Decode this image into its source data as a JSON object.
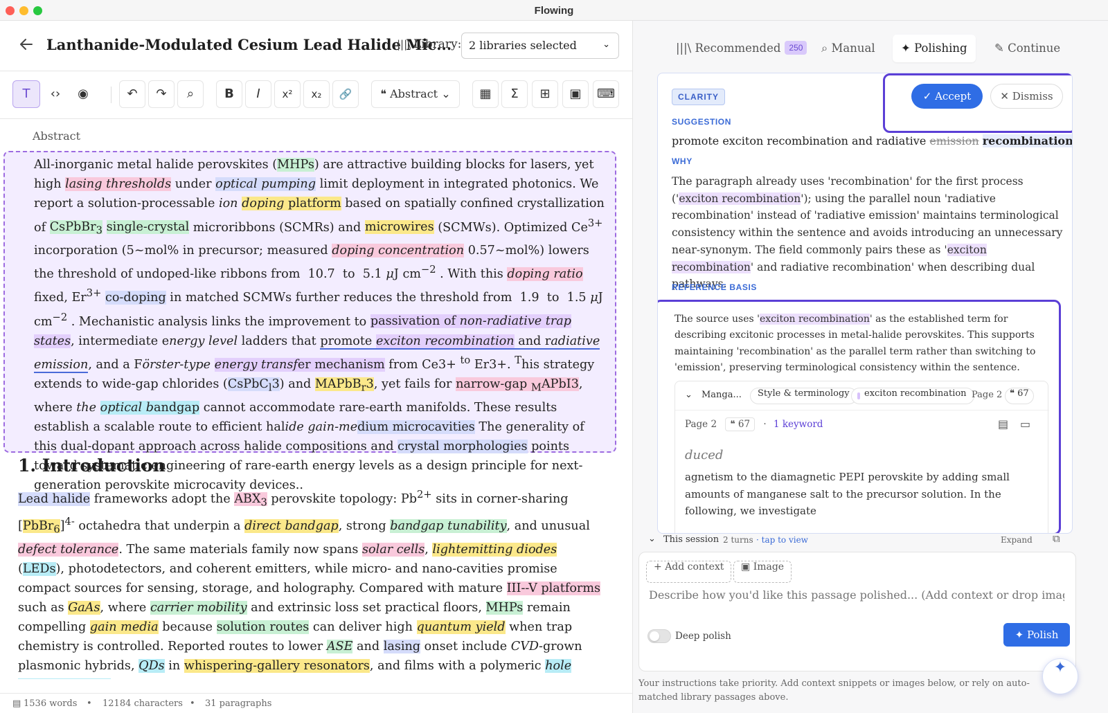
{
  "window": {
    "title": "Flowing"
  },
  "header": {
    "doc_title": "Lanthanide-Modulated Cesium Lead Halide Mic...",
    "library_label": "Library:",
    "library_value": "2 libraries selected"
  },
  "toolbar": {
    "text_mode": "T",
    "code_mode": "‹›",
    "preview_mode": "◉",
    "undo": "↶",
    "redo": "↷",
    "search": "⌕",
    "bold": "B",
    "italic": "I",
    "superscript": "x²",
    "subscript": "x₂",
    "link": "🔗",
    "cite_label": "Abstract",
    "calc": "▦",
    "sigma": "Σ",
    "table": "⊞",
    "image": "▣",
    "keyboard": "⌨"
  },
  "editor": {
    "section_label": "Abstract",
    "intro_heading": "1. Introduction"
  },
  "status": {
    "words": "1536 words",
    "characters": "12184 characters",
    "paragraphs": "31 paragraphs"
  },
  "tabs": {
    "recommended": "Recommended",
    "recommended_count": "250",
    "manual": "Manual",
    "polishing": "Polishing",
    "continue": "Continue"
  },
  "suggestion_card": {
    "category": "CLARITY",
    "accept": "Accept",
    "dismiss": "Dismiss",
    "suggestion_heading": "SUGGESTION",
    "suggestion_prefix": "promote exciton recombination and radiative ",
    "suggestion_removed": "emission",
    "suggestion_added": "recombination",
    "why_heading": "WHY",
    "reference_heading": "REFERENCE BASIS",
    "reference_text_1": "The source uses '",
    "reference_kw": "exciton recombination",
    "reference_text_2": "' as the established term for describing excitonic processes in metal-halide perovskites. This supports maintaining 'recombination' as the parallel term rather than switching to 'emission', preserving terminological consistency within the sentence.",
    "source": {
      "name": "Manga...",
      "chip_style": "Style & terminology",
      "chip_kw": "exciton recombination",
      "page": "Page 2",
      "quote_count": "67",
      "meta_page": "Page 2",
      "meta_count": "67",
      "meta_keywords": "1 keyword",
      "dim_word": "duced",
      "body": "agnetism to the diamagnetic PEPI perovskite by adding small amounts of manganese salt to the precursor solution. In the following, we investigate"
    }
  },
  "session": {
    "label": "This session",
    "turns": "2 turns",
    "tap": "· tap to view",
    "expand": "Expand"
  },
  "composer": {
    "add_context": "Add context",
    "image": "Image",
    "placeholder": "Describe how you'd like this passage polished... (Add context or drop images)",
    "deep_polish": "Deep polish",
    "polish": "Polish"
  },
  "hint": "Your instructions take priority. Add context snippets or images below, or rely on auto-matched library passages above.",
  "colors": {
    "accent": "#2f6de5",
    "purple": "#5b3fd6",
    "abstract_bg": "#f3edff"
  }
}
